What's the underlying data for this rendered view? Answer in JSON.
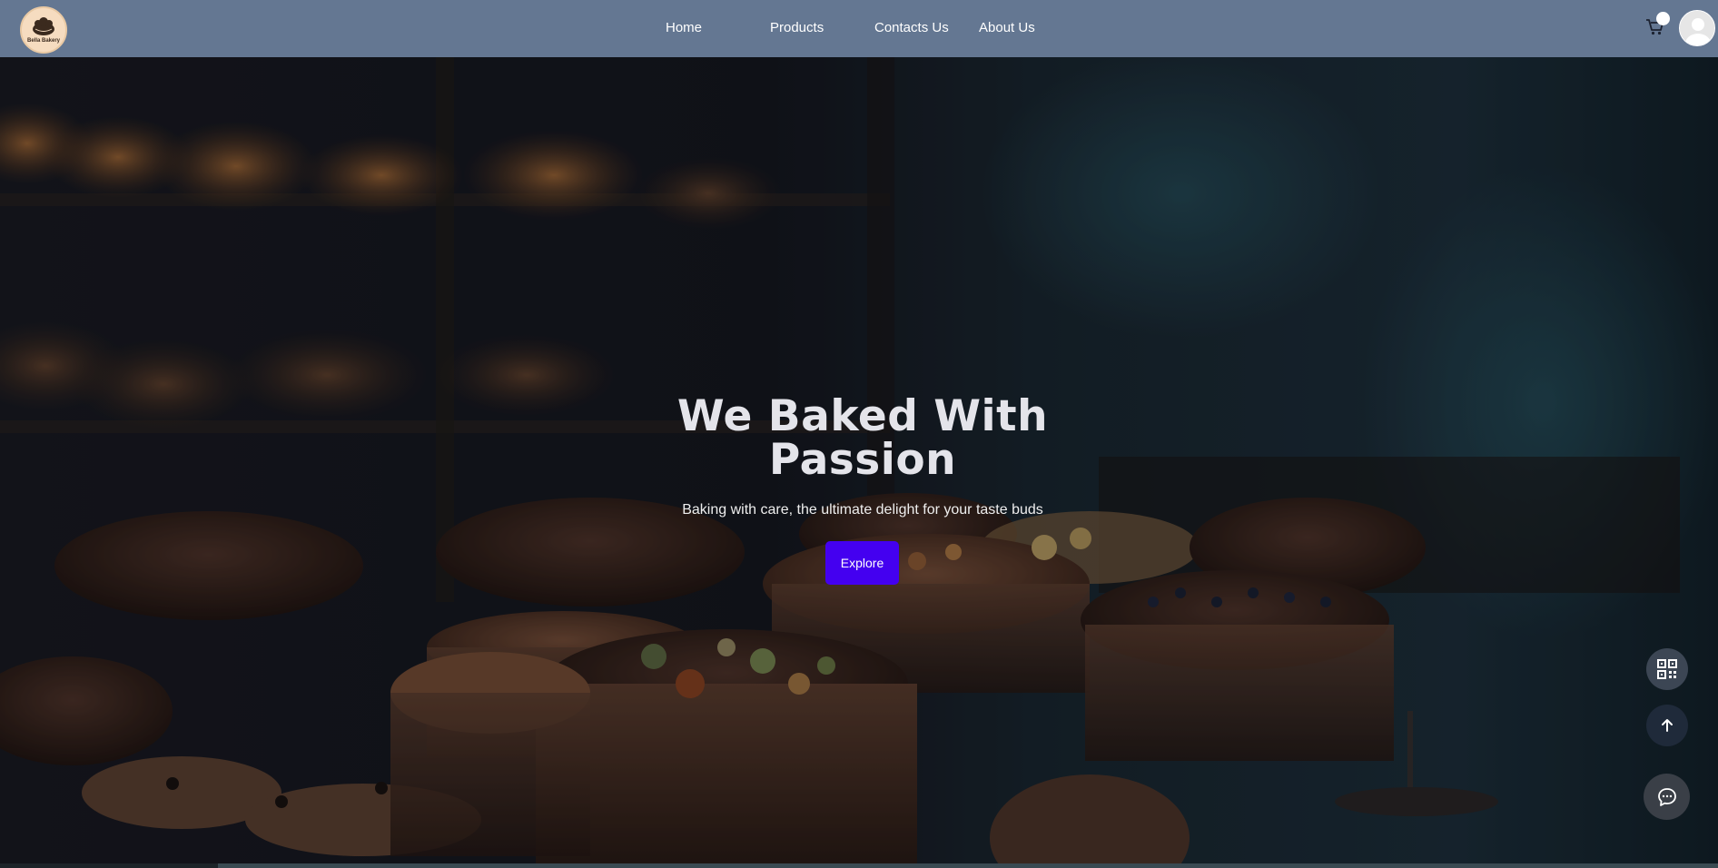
{
  "brand": {
    "logo_text": "Bella Bakery"
  },
  "nav": {
    "items": [
      {
        "label": "Home"
      },
      {
        "label": "Products"
      },
      {
        "label": "Contacts Us"
      },
      {
        "label": "About Us"
      }
    ]
  },
  "header_icons": {
    "cart": "cart-icon",
    "avatar": "user-avatar"
  },
  "hero": {
    "title": "We Baked With Passion",
    "subtitle": "Baking with care, the ultimate delight for your taste buds",
    "cta_label": "Explore"
  },
  "floating_actions": {
    "qr": "qr-code-icon",
    "scroll_top": "arrow-up-icon",
    "chat": "chat-icon"
  },
  "colors": {
    "navbar": "#647792",
    "cta": "#4400f0",
    "title": "#e4e4ea"
  }
}
